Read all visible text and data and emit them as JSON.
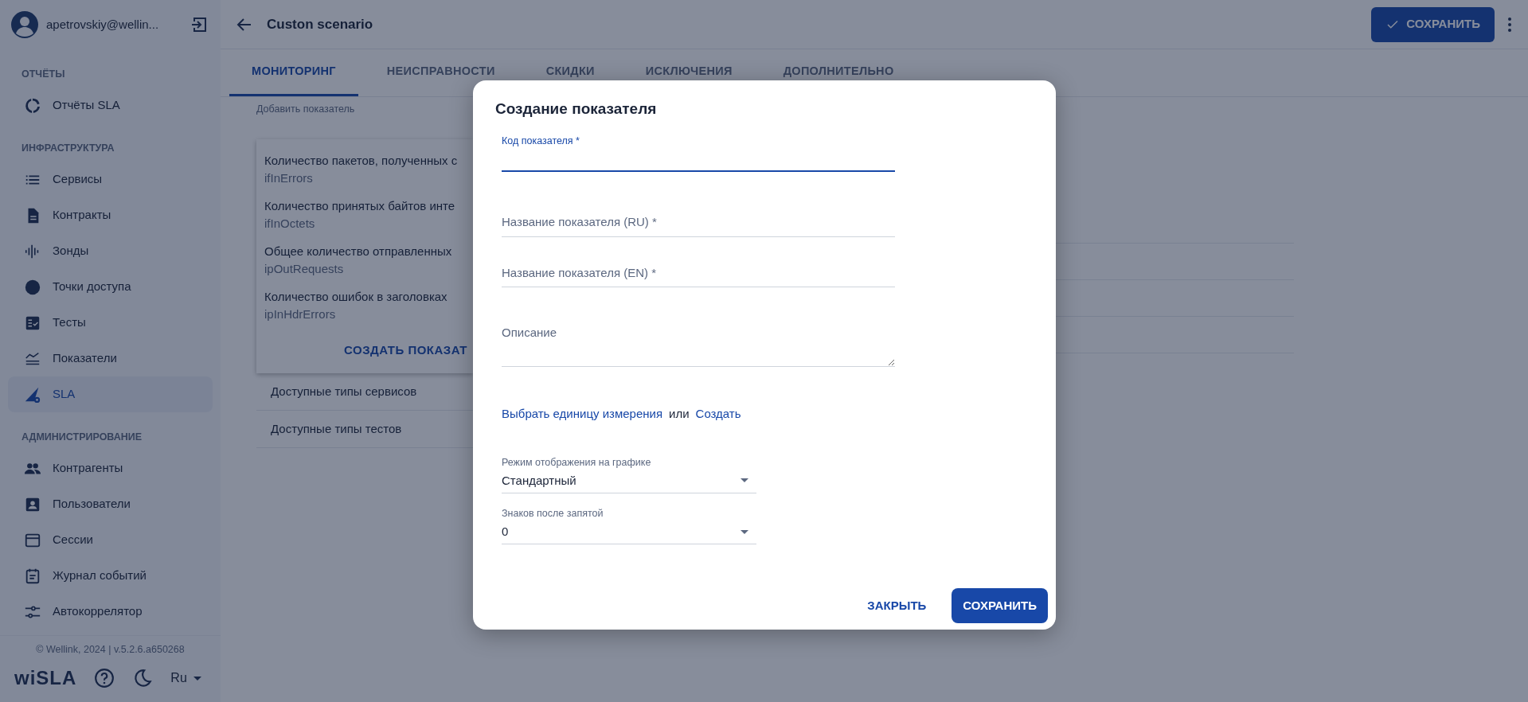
{
  "sidebar": {
    "user": "apetrovskiy@wellin...",
    "sections": [
      {
        "title": "ОТЧЁТЫ",
        "items": [
          {
            "label": "Отчёты SLA",
            "selected": false
          }
        ]
      },
      {
        "title": "ИНФРАСТРУКТУРА",
        "items": [
          {
            "label": "Сервисы",
            "selected": false
          },
          {
            "label": "Контракты",
            "selected": false
          },
          {
            "label": "Зонды",
            "selected": false
          },
          {
            "label": "Точки доступа",
            "selected": false
          },
          {
            "label": "Тесты",
            "selected": false
          },
          {
            "label": "Показатели",
            "selected": false
          },
          {
            "label": "SLA",
            "selected": true
          }
        ]
      },
      {
        "title": "АДМИНИСТРИРОВАНИЕ",
        "items": [
          {
            "label": "Контрагенты",
            "selected": false
          },
          {
            "label": "Пользователи",
            "selected": false
          },
          {
            "label": "Сессии",
            "selected": false
          },
          {
            "label": "Журнал событий",
            "selected": false
          },
          {
            "label": "Автокоррелятор",
            "selected": false
          }
        ]
      }
    ],
    "footer": "© Wellink, 2024 | v.5.2.6.a650268",
    "logo": "wiSLA",
    "language": "Ru"
  },
  "header": {
    "title": "Custon scenario",
    "save_button": "СОХРАНИТЬ"
  },
  "tabs": [
    {
      "label": "МОНИТОРИНГ",
      "selected": true
    },
    {
      "label": "НЕИСПРАВНОСТИ",
      "selected": false
    },
    {
      "label": "СКИДКИ",
      "selected": false
    },
    {
      "label": "ИСКЛЮЧЕНИЯ",
      "selected": false
    },
    {
      "label": "ДОПОЛНИТЕЛЬНО",
      "selected": false
    }
  ],
  "hint": "Добавить показатель",
  "metric_list": {
    "items": [
      {
        "name": "Количество пакетов, полученных с",
        "code": "ifInErrors"
      },
      {
        "name": "Количество принятых байтов инте",
        "code": "ifInOctets"
      },
      {
        "name": "Общее количество отправленных",
        "code": "ipOutRequests"
      },
      {
        "name": "Количество ошибок в заголовках",
        "code": "ipInHdrErrors"
      }
    ],
    "create_button": "СОЗДАТЬ ПОКАЗАТ"
  },
  "rows": [
    "Доступные типы сервисов",
    "Доступные типы тестов"
  ],
  "dialog": {
    "title": "Создание показателя",
    "fields": [
      {
        "kind": "input",
        "label": "Код показателя *",
        "focused": true
      },
      {
        "kind": "input",
        "placeholder": "Название показателя (RU) *",
        "focused": false
      },
      {
        "kind": "input",
        "placeholder": "Название показателя (EN) *",
        "focused": false
      },
      {
        "kind": "textarea",
        "placeholder": "Описание",
        "focused": false
      }
    ],
    "unit_links": [
      {
        "kind": "link",
        "text": "Выбрать единицу измерения"
      },
      {
        "kind": "text",
        "text": "или"
      },
      {
        "kind": "link",
        "text": "Создать"
      }
    ],
    "selects": [
      {
        "label": "Режим отображения на графике",
        "value": "Стандартный"
      },
      {
        "label": "Знаков после запятой",
        "value": "0"
      }
    ],
    "buttons": [
      {
        "label": "ЗАКРЫТЬ",
        "kind": "text"
      },
      {
        "label": "СОХРАНИТЬ",
        "kind": "primary"
      }
    ]
  }
}
